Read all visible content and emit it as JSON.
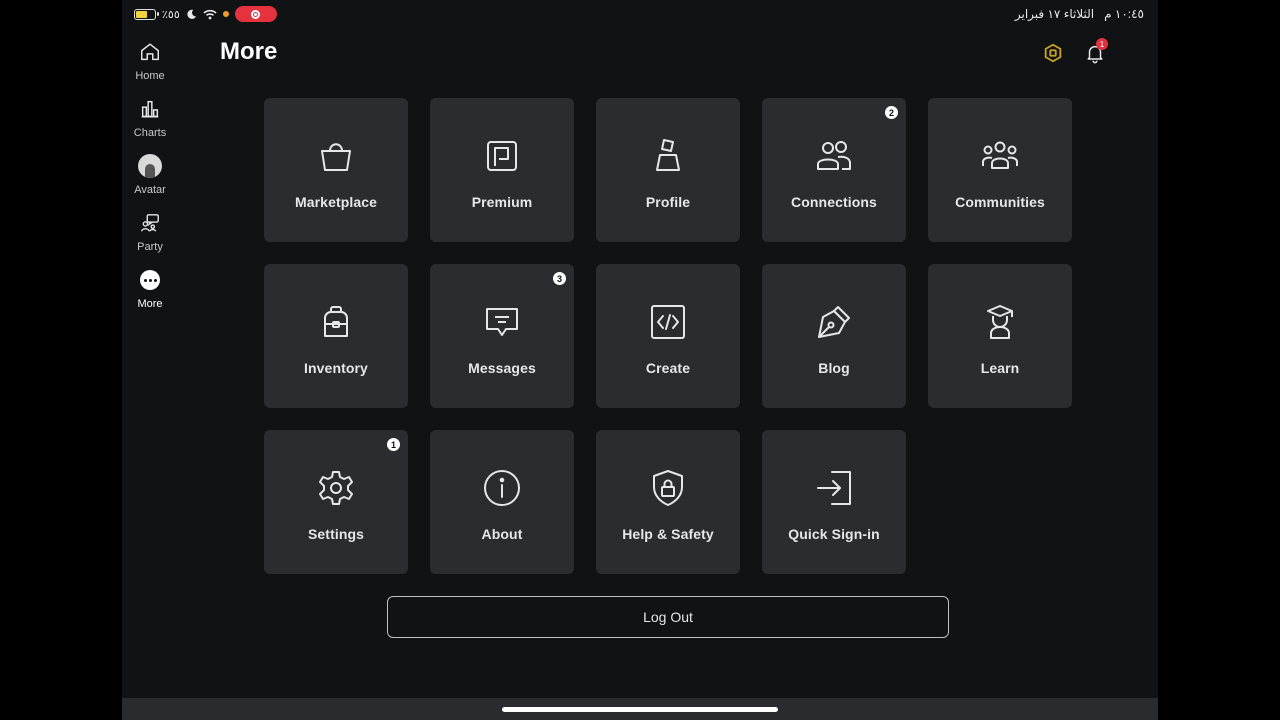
{
  "status_bar": {
    "battery_percent": "٪٥٥",
    "battery_level": 0.55,
    "time": "١٠:٤٥ م",
    "date": "الثلاثاء ١٧ فبراير"
  },
  "sidebar": {
    "items": [
      {
        "label": "Home",
        "icon": "home-icon"
      },
      {
        "label": "Charts",
        "icon": "charts-icon"
      },
      {
        "label": "Avatar",
        "icon": "avatar-icon"
      },
      {
        "label": "Party",
        "icon": "party-icon"
      },
      {
        "label": "More",
        "icon": "more-icon",
        "active": true
      }
    ]
  },
  "header": {
    "title": "More",
    "notification_count": "1"
  },
  "tiles": [
    {
      "label": "Marketplace",
      "icon": "shopping-bag-icon"
    },
    {
      "label": "Premium",
      "icon": "premium-icon"
    },
    {
      "label": "Profile",
      "icon": "profile-icon"
    },
    {
      "label": "Connections",
      "icon": "connections-icon",
      "badge": "2"
    },
    {
      "label": "Communities",
      "icon": "communities-icon"
    },
    {
      "label": "Inventory",
      "icon": "backpack-icon"
    },
    {
      "label": "Messages",
      "icon": "message-icon",
      "badge": "3"
    },
    {
      "label": "Create",
      "icon": "code-icon"
    },
    {
      "label": "Blog",
      "icon": "pen-icon"
    },
    {
      "label": "Learn",
      "icon": "learn-icon"
    },
    {
      "label": "Settings",
      "icon": "gear-icon",
      "badge": "1"
    },
    {
      "label": "About",
      "icon": "info-icon"
    },
    {
      "label": "Help & Safety",
      "icon": "shield-lock-icon"
    },
    {
      "label": "Quick Sign-in",
      "icon": "sign-in-icon"
    }
  ],
  "logout_label": "Log Out",
  "colors": {
    "background": "#111214",
    "tile": "#2a2c30",
    "badge_red": "#e0313f",
    "robux_gold": "#c9a227"
  }
}
